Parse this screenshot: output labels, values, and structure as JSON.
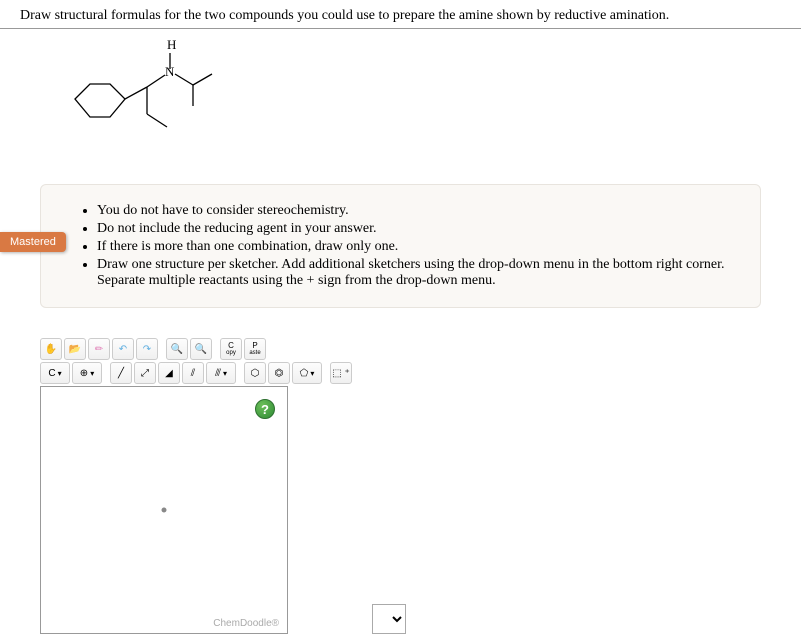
{
  "question": "Draw structural formulas for the two compounds you could use to prepare the amine shown by reductive amination.",
  "molecule_label": {
    "h": "H",
    "n": "N"
  },
  "instructions": [
    "You do not have to consider stereochemistry.",
    "Do not include the reducing agent in your answer.",
    "If there is more than one combination, draw only one.",
    "Draw one structure per sketcher. Add additional sketchers using the drop-down menu in the bottom right corner. Separate multiple reactants using the + sign from the drop-down menu."
  ],
  "badge": "Mastered",
  "toolbar": {
    "copy": "C",
    "copy_sub": "opy",
    "paste": "P",
    "paste_sub": "aste",
    "element": "C",
    "charge": "⊕",
    "marquee": "⬚ ⁺"
  },
  "help_icon": "?",
  "brand": "ChemDoodle®"
}
